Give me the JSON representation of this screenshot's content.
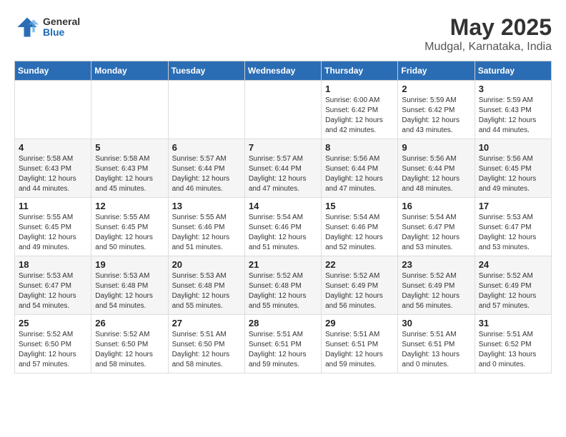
{
  "logo": {
    "general": "General",
    "blue": "Blue"
  },
  "title": "May 2025",
  "subtitle": "Mudgal, Karnataka, India",
  "days_of_week": [
    "Sunday",
    "Monday",
    "Tuesday",
    "Wednesday",
    "Thursday",
    "Friday",
    "Saturday"
  ],
  "weeks": [
    [
      {
        "day": "",
        "info": ""
      },
      {
        "day": "",
        "info": ""
      },
      {
        "day": "",
        "info": ""
      },
      {
        "day": "",
        "info": ""
      },
      {
        "day": "1",
        "info": "Sunrise: 6:00 AM\nSunset: 6:42 PM\nDaylight: 12 hours\nand 42 minutes."
      },
      {
        "day": "2",
        "info": "Sunrise: 5:59 AM\nSunset: 6:42 PM\nDaylight: 12 hours\nand 43 minutes."
      },
      {
        "day": "3",
        "info": "Sunrise: 5:59 AM\nSunset: 6:43 PM\nDaylight: 12 hours\nand 44 minutes."
      }
    ],
    [
      {
        "day": "4",
        "info": "Sunrise: 5:58 AM\nSunset: 6:43 PM\nDaylight: 12 hours\nand 44 minutes."
      },
      {
        "day": "5",
        "info": "Sunrise: 5:58 AM\nSunset: 6:43 PM\nDaylight: 12 hours\nand 45 minutes."
      },
      {
        "day": "6",
        "info": "Sunrise: 5:57 AM\nSunset: 6:44 PM\nDaylight: 12 hours\nand 46 minutes."
      },
      {
        "day": "7",
        "info": "Sunrise: 5:57 AM\nSunset: 6:44 PM\nDaylight: 12 hours\nand 47 minutes."
      },
      {
        "day": "8",
        "info": "Sunrise: 5:56 AM\nSunset: 6:44 PM\nDaylight: 12 hours\nand 47 minutes."
      },
      {
        "day": "9",
        "info": "Sunrise: 5:56 AM\nSunset: 6:44 PM\nDaylight: 12 hours\nand 48 minutes."
      },
      {
        "day": "10",
        "info": "Sunrise: 5:56 AM\nSunset: 6:45 PM\nDaylight: 12 hours\nand 49 minutes."
      }
    ],
    [
      {
        "day": "11",
        "info": "Sunrise: 5:55 AM\nSunset: 6:45 PM\nDaylight: 12 hours\nand 49 minutes."
      },
      {
        "day": "12",
        "info": "Sunrise: 5:55 AM\nSunset: 6:45 PM\nDaylight: 12 hours\nand 50 minutes."
      },
      {
        "day": "13",
        "info": "Sunrise: 5:55 AM\nSunset: 6:46 PM\nDaylight: 12 hours\nand 51 minutes."
      },
      {
        "day": "14",
        "info": "Sunrise: 5:54 AM\nSunset: 6:46 PM\nDaylight: 12 hours\nand 51 minutes."
      },
      {
        "day": "15",
        "info": "Sunrise: 5:54 AM\nSunset: 6:46 PM\nDaylight: 12 hours\nand 52 minutes."
      },
      {
        "day": "16",
        "info": "Sunrise: 5:54 AM\nSunset: 6:47 PM\nDaylight: 12 hours\nand 53 minutes."
      },
      {
        "day": "17",
        "info": "Sunrise: 5:53 AM\nSunset: 6:47 PM\nDaylight: 12 hours\nand 53 minutes."
      }
    ],
    [
      {
        "day": "18",
        "info": "Sunrise: 5:53 AM\nSunset: 6:47 PM\nDaylight: 12 hours\nand 54 minutes."
      },
      {
        "day": "19",
        "info": "Sunrise: 5:53 AM\nSunset: 6:48 PM\nDaylight: 12 hours\nand 54 minutes."
      },
      {
        "day": "20",
        "info": "Sunrise: 5:53 AM\nSunset: 6:48 PM\nDaylight: 12 hours\nand 55 minutes."
      },
      {
        "day": "21",
        "info": "Sunrise: 5:52 AM\nSunset: 6:48 PM\nDaylight: 12 hours\nand 55 minutes."
      },
      {
        "day": "22",
        "info": "Sunrise: 5:52 AM\nSunset: 6:49 PM\nDaylight: 12 hours\nand 56 minutes."
      },
      {
        "day": "23",
        "info": "Sunrise: 5:52 AM\nSunset: 6:49 PM\nDaylight: 12 hours\nand 56 minutes."
      },
      {
        "day": "24",
        "info": "Sunrise: 5:52 AM\nSunset: 6:49 PM\nDaylight: 12 hours\nand 57 minutes."
      }
    ],
    [
      {
        "day": "25",
        "info": "Sunrise: 5:52 AM\nSunset: 6:50 PM\nDaylight: 12 hours\nand 57 minutes."
      },
      {
        "day": "26",
        "info": "Sunrise: 5:52 AM\nSunset: 6:50 PM\nDaylight: 12 hours\nand 58 minutes."
      },
      {
        "day": "27",
        "info": "Sunrise: 5:51 AM\nSunset: 6:50 PM\nDaylight: 12 hours\nand 58 minutes."
      },
      {
        "day": "28",
        "info": "Sunrise: 5:51 AM\nSunset: 6:51 PM\nDaylight: 12 hours\nand 59 minutes."
      },
      {
        "day": "29",
        "info": "Sunrise: 5:51 AM\nSunset: 6:51 PM\nDaylight: 12 hours\nand 59 minutes."
      },
      {
        "day": "30",
        "info": "Sunrise: 5:51 AM\nSunset: 6:51 PM\nDaylight: 13 hours\nand 0 minutes."
      },
      {
        "day": "31",
        "info": "Sunrise: 5:51 AM\nSunset: 6:52 PM\nDaylight: 13 hours\nand 0 minutes."
      }
    ]
  ]
}
